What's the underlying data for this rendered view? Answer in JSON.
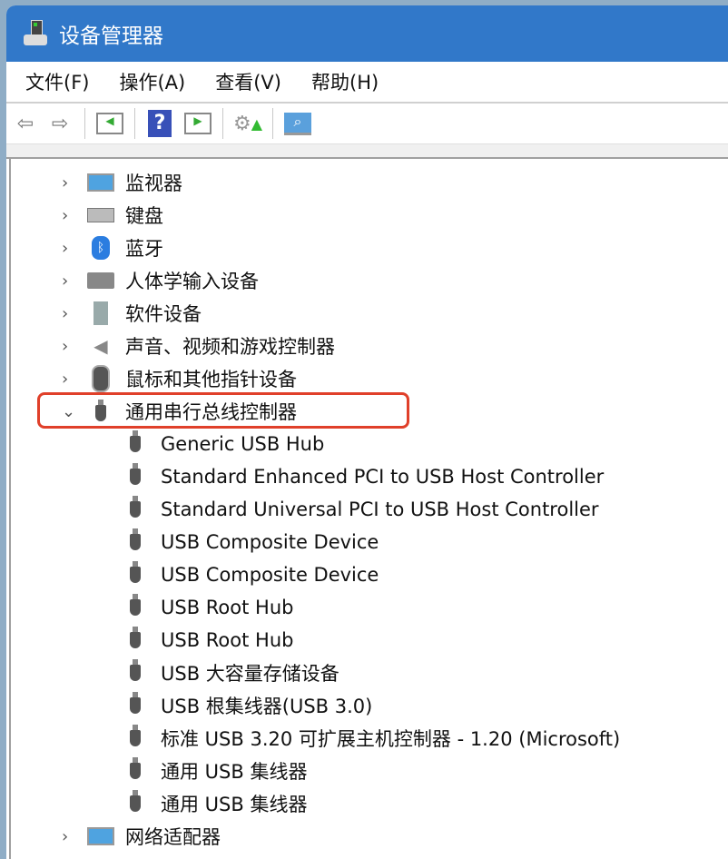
{
  "window": {
    "title": "设备管理器",
    "accent": "#3178c9"
  },
  "menu": [
    "文件(F)",
    "操作(A)",
    "查看(V)",
    "帮助(H)"
  ],
  "toolbar": [
    "back-icon",
    "forward-icon",
    "show-hide-console-tree-icon",
    "help-icon",
    "show-hide-action-pane-icon",
    "update-driver-icon",
    "scan-hardware-icon"
  ],
  "tree": {
    "categories_before": [
      {
        "label": "监视器",
        "icon": "monitor-icon"
      },
      {
        "label": "键盘",
        "icon": "keyboard-icon"
      },
      {
        "label": "蓝牙",
        "icon": "bluetooth-icon"
      },
      {
        "label": "人体学输入设备",
        "icon": "hid-icon"
      },
      {
        "label": "软件设备",
        "icon": "software-device-icon"
      },
      {
        "label": "声音、视频和游戏控制器",
        "icon": "speaker-icon"
      },
      {
        "label": "鼠标和其他指针设备",
        "icon": "mouse-icon"
      }
    ],
    "expanded": {
      "label": "通用串行总线控制器",
      "icon": "usb-icon",
      "highlight": "#e0402a"
    },
    "children": [
      "Generic USB Hub",
      "Standard Enhanced PCI to USB Host Controller",
      "Standard Universal PCI to USB Host Controller",
      "USB Composite Device",
      "USB Composite Device",
      "USB Root Hub",
      "USB Root Hub",
      "USB 大容量存储设备",
      "USB 根集线器(USB 3.0)",
      "标准 USB 3.20 可扩展主机控制器 - 1.20 (Microsoft)",
      "通用 USB 集线器",
      "通用 USB 集线器"
    ],
    "categories_after": [
      {
        "label": "网络适配器",
        "icon": "network-adapter-icon"
      }
    ]
  }
}
